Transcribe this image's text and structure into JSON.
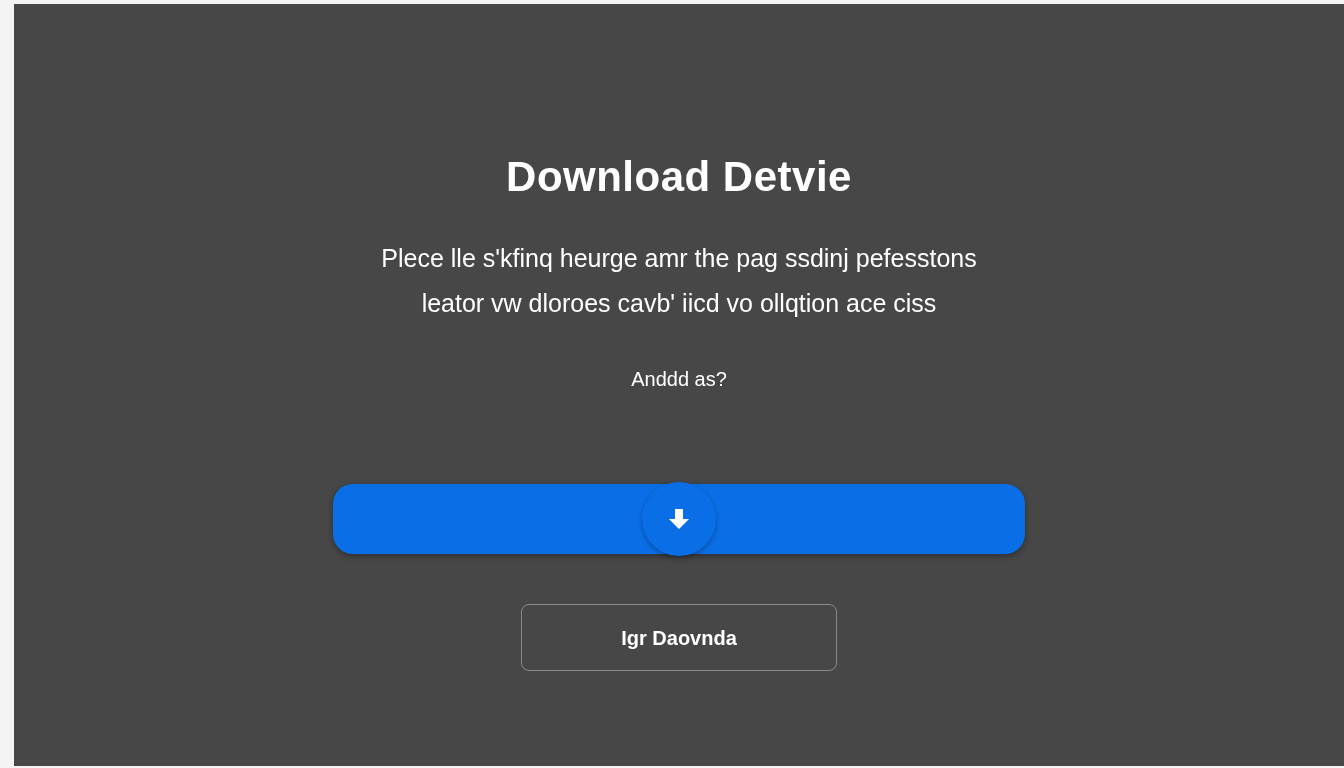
{
  "title": "Download Detvie",
  "description": {
    "lines": [
      "Plece lle s'kfinq heurge amr the pag ssdinj pefesstons",
      "leator vw dloroes cavb' iicd vo ollqtion ace ciss"
    ]
  },
  "subtitle": "Anddd as?",
  "download_bar": {
    "kind": "download"
  },
  "secondary_button": {
    "label": "Igr Daovnda"
  }
}
